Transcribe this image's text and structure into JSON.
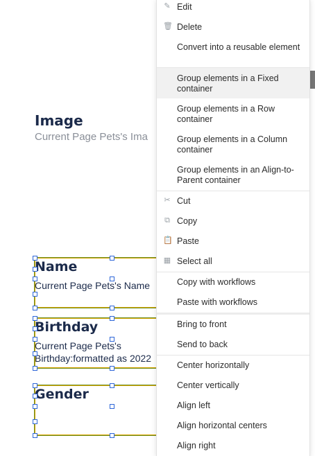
{
  "canvas": {
    "image_element": {
      "title": "Image",
      "subtitle": "Current Page Pets's Ima"
    },
    "fields": [
      {
        "label": "Name",
        "value_lines": [
          "Current Page Pets's Name"
        ]
      },
      {
        "label": "Birthday",
        "value_lines": [
          "Current Page Pets's",
          "Birthday:formatted as 2022"
        ]
      },
      {
        "label": "Gender",
        "value_lines": []
      }
    ]
  },
  "context_menu": {
    "items": [
      {
        "label": "Edit",
        "icon": "pencil-icon"
      },
      {
        "label": "Delete",
        "icon": "trash-icon"
      },
      {
        "label": "Convert into a reusable element",
        "icon": ""
      },
      {
        "label": "Group elements in a Fixed container",
        "icon": ""
      },
      {
        "label": "Group elements in a Row container",
        "icon": ""
      },
      {
        "label": "Group elements in a Column container",
        "icon": ""
      },
      {
        "label": "Group elements in an Align-to-Parent container",
        "icon": ""
      },
      {
        "label": "Cut",
        "icon": "scissors-icon"
      },
      {
        "label": "Copy",
        "icon": "copy-icon"
      },
      {
        "label": "Paste",
        "icon": "paste-icon"
      },
      {
        "label": "Select all",
        "icon": "grid-icon"
      },
      {
        "label": "Copy with workflows",
        "icon": ""
      },
      {
        "label": "Paste with workflows",
        "icon": ""
      },
      {
        "label": "Bring to front",
        "icon": ""
      },
      {
        "label": "Send to back",
        "icon": ""
      },
      {
        "label": "Center horizontally",
        "icon": ""
      },
      {
        "label": "Center vertically",
        "icon": ""
      },
      {
        "label": "Align left",
        "icon": ""
      },
      {
        "label": "Align horizontal centers",
        "icon": ""
      },
      {
        "label": "Align right",
        "icon": ""
      }
    ],
    "highlighted_item": "Group elements in a Fixed container"
  },
  "colors": {
    "accent": "#2d66d8",
    "heading": "#1b2a4a",
    "muted": "#8a8f98"
  }
}
